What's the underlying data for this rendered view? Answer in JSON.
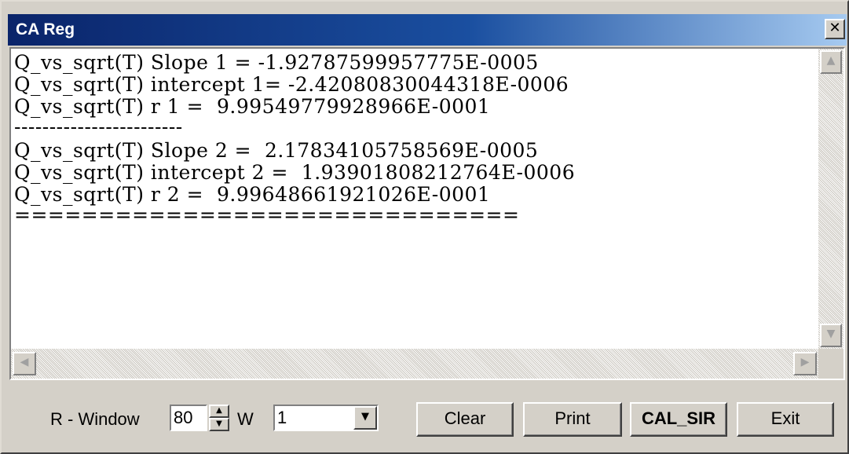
{
  "window": {
    "title": "CA Reg",
    "close_glyph": "✕"
  },
  "output": {
    "lines": [
      "Q_vs_sqrt(T) Slope 1 = -1.92787599957775E-0005",
      "Q_vs_sqrt(T) intercept 1= -2.42080830044318E-0006",
      "Q_vs_sqrt(T) r 1 =  9.99549779928966E-0001",
      "------------------------",
      "Q_vs_sqrt(T) Slope 2 =  2.17834105758569E-0005",
      "Q_vs_sqrt(T) intercept 2 =  1.93901808212764E-0006",
      "Q_vs_sqrt(T) r 2 =  9.99648661921026E-0001",
      "=============================="
    ]
  },
  "scrollbars": {
    "up_icon": "▲",
    "down_icon": "▼",
    "left_icon": "◀",
    "right_icon": "▶"
  },
  "controls": {
    "r_window_label": "R - Window",
    "r_window_value": "80",
    "spin_up_icon": "▲",
    "spin_down_icon": "▼",
    "w_label": "W",
    "w_value": "1",
    "dropdown_icon": "▼",
    "clear_label": "Clear",
    "print_label": "Print",
    "cal_sir_label": "CAL_SIR",
    "exit_label": "Exit"
  }
}
